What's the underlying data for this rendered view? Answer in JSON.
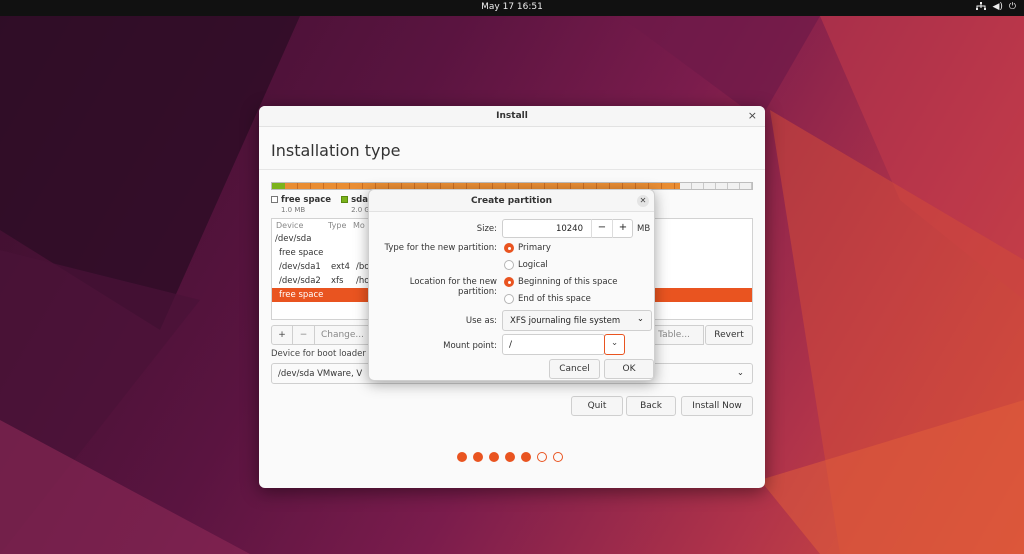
{
  "topbar": {
    "clock": "May 17  16:51"
  },
  "window": {
    "title": "Install",
    "close_glyph": "×",
    "page_title": "Installation type"
  },
  "partition_bar": [
    {
      "name": "free space",
      "size": "1.0 MB",
      "color": "#ffffff"
    },
    {
      "name": "sda1",
      "size": "2.0 G",
      "color": "#7bb31b"
    }
  ],
  "table": {
    "headers": [
      "Device",
      "Type",
      "Mo"
    ],
    "rows": [
      {
        "device": "/dev/sda",
        "type": "",
        "mount": ""
      },
      {
        "device": "free space",
        "type": "",
        "mount": ""
      },
      {
        "device": "/dev/sda1",
        "type": "ext4",
        "mount": "/bo"
      },
      {
        "device": "/dev/sda2",
        "type": "xfs",
        "mount": "/ho"
      },
      {
        "device": "free space",
        "type": "",
        "mount": ""
      }
    ]
  },
  "table_buttons": {
    "add": "+",
    "remove": "−",
    "change": "Change...",
    "new_table": "Table...",
    "revert": "Revert"
  },
  "bootloader": {
    "label": "Device for boot loader i",
    "value": "/dev/sda   VMware, V"
  },
  "nav_buttons": {
    "quit": "Quit",
    "back": "Back",
    "install": "Install Now"
  },
  "progress": {
    "steps_total": 7,
    "steps_done": 5
  },
  "dialog": {
    "title": "Create partition",
    "size_label": "Size:",
    "size_value": "10240",
    "size_minus": "−",
    "size_plus": "+",
    "size_unit": "MB",
    "type_label": "Type for the new partition:",
    "type_primary": "Primary",
    "type_logical": "Logical",
    "location_label": "Location for the new partition:",
    "loc_begin": "Beginning of this space",
    "loc_end": "End of this space",
    "useas_label": "Use as:",
    "useas_value": "XFS journaling file system",
    "mount_label": "Mount point:",
    "mount_value": "/",
    "cancel": "Cancel",
    "ok": "OK"
  },
  "colors": {
    "accent": "#e95420",
    "ubuntu_green": "#7bb31b"
  }
}
